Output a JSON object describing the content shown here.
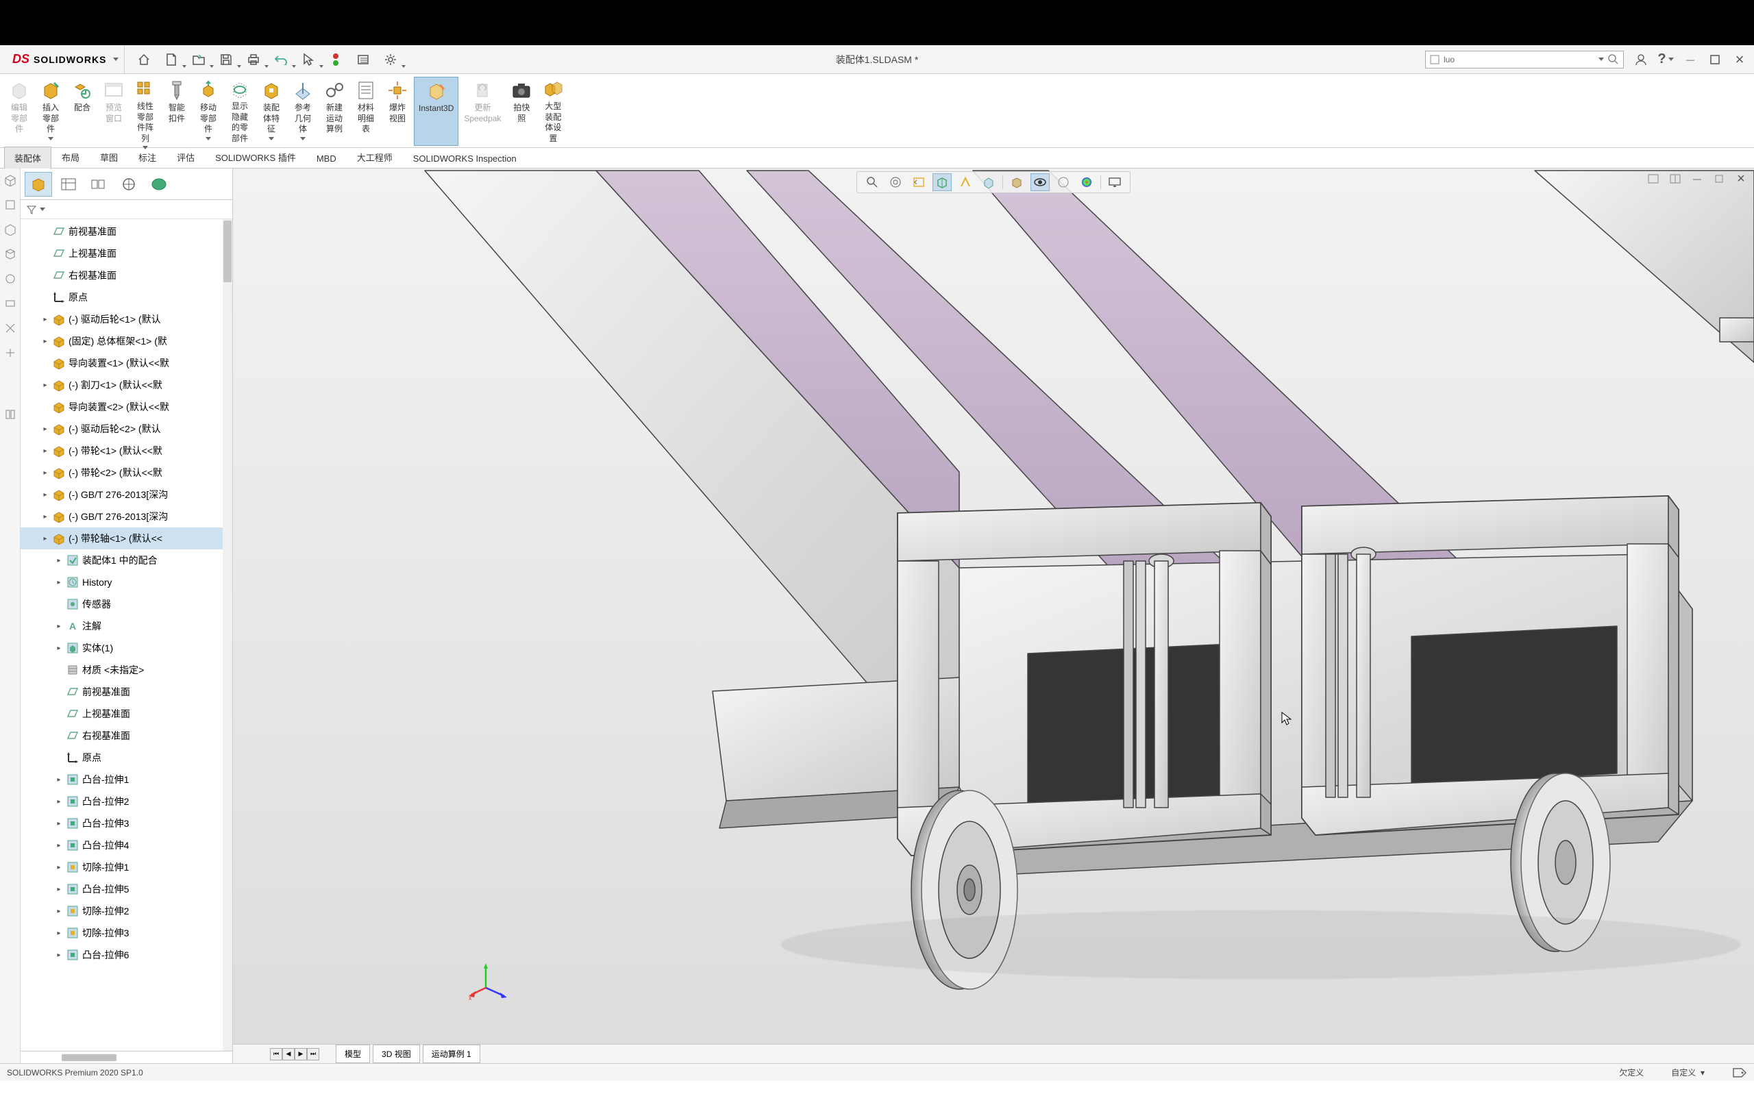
{
  "app": {
    "name": "SOLIDWORKS",
    "document": "装配体1.SLDASM *"
  },
  "search": {
    "placeholder": "luo"
  },
  "ribbonButtons": [
    {
      "id": "edit-part",
      "label": "编辑零部件",
      "disabled": true
    },
    {
      "id": "insert-part",
      "label": "插入零部件",
      "dd": true
    },
    {
      "id": "mate",
      "label": "配合"
    },
    {
      "id": "preview-win",
      "label": "预览窗口",
      "disabled": true
    },
    {
      "id": "linear-pattern",
      "label": "线性零部件阵列",
      "dd": true
    },
    {
      "id": "smart-fastener",
      "label": "智能扣件"
    },
    {
      "id": "move-part",
      "label": "移动零部件",
      "dd": true
    },
    {
      "id": "show-hidden",
      "label": "显示隐藏的零部件"
    },
    {
      "id": "assembly-features",
      "label": "装配体特征",
      "dd": true
    },
    {
      "id": "ref-geom",
      "label": "参考几何体",
      "dd": true
    },
    {
      "id": "new-motion",
      "label": "新建运动算例"
    },
    {
      "id": "bom",
      "label": "材料明细表"
    },
    {
      "id": "exploded",
      "label": "爆炸视图"
    },
    {
      "id": "instant3d",
      "label": "Instant3D",
      "active": true
    },
    {
      "id": "update-speedpak",
      "label": "更新Speedpak",
      "disabled": true
    },
    {
      "id": "snapshot",
      "label": "拍快照"
    },
    {
      "id": "large-asm",
      "label": "大型装配体设置"
    }
  ],
  "ribbonTabs": [
    "装配体",
    "布局",
    "草图",
    "标注",
    "评估",
    "SOLIDWORKS 插件",
    "MBD",
    "大工程师",
    "SOLIDWORKS Inspection"
  ],
  "activeRibbonTab": 0,
  "treeItems": [
    {
      "icon": "plane",
      "label": "前视基准面",
      "indent": 1
    },
    {
      "icon": "plane",
      "label": "上视基准面",
      "indent": 1
    },
    {
      "icon": "plane",
      "label": "右视基准面",
      "indent": 1
    },
    {
      "icon": "origin",
      "label": "原点",
      "indent": 1
    },
    {
      "icon": "asm",
      "label": "(-) 驱动后轮<1> (默认",
      "indent": 1,
      "exp": true
    },
    {
      "icon": "asm",
      "label": "(固定) 总体框架<1> (默",
      "indent": 1,
      "exp": true
    },
    {
      "icon": "asm",
      "label": "导向装置<1> (默认<<默",
      "indent": 1
    },
    {
      "icon": "asm",
      "label": "(-) 割刀<1> (默认<<默",
      "indent": 1,
      "exp": true
    },
    {
      "icon": "asm",
      "label": "导向装置<2> (默认<<默",
      "indent": 1
    },
    {
      "icon": "asm",
      "label": "(-) 驱动后轮<2> (默认",
      "indent": 1,
      "exp": true
    },
    {
      "icon": "asm",
      "label": "(-) 带轮<1> (默认<<默",
      "indent": 1,
      "exp": true
    },
    {
      "icon": "asm",
      "label": "(-) 带轮<2> (默认<<默",
      "indent": 1,
      "exp": true
    },
    {
      "icon": "asm",
      "label": "(-) GB/T 276-2013[深沟",
      "indent": 1,
      "exp": true
    },
    {
      "icon": "asm",
      "label": "(-) GB/T 276-2013[深沟",
      "indent": 1,
      "exp": true
    },
    {
      "icon": "asm",
      "label": "(-) 带轮轴<1> (默认<<",
      "indent": 1,
      "exp": true,
      "selected": true
    },
    {
      "icon": "mates",
      "label": "装配体1 中的配合",
      "indent": 2,
      "exp": true
    },
    {
      "icon": "history",
      "label": "History",
      "indent": 2,
      "exp": true
    },
    {
      "icon": "sensor",
      "label": "传感器",
      "indent": 2
    },
    {
      "icon": "annot",
      "label": "注解",
      "indent": 2,
      "exp": true
    },
    {
      "icon": "solid",
      "label": "实体(1)",
      "indent": 2,
      "exp": true
    },
    {
      "icon": "material",
      "label": "材质 <未指定>",
      "indent": 2
    },
    {
      "icon": "plane",
      "label": "前视基准面",
      "indent": 2
    },
    {
      "icon": "plane",
      "label": "上视基准面",
      "indent": 2
    },
    {
      "icon": "plane",
      "label": "右视基准面",
      "indent": 2
    },
    {
      "icon": "origin",
      "label": "原点",
      "indent": 2
    },
    {
      "icon": "extrude",
      "label": "凸台-拉伸1",
      "indent": 2,
      "exp": true
    },
    {
      "icon": "extrude",
      "label": "凸台-拉伸2",
      "indent": 2,
      "exp": true
    },
    {
      "icon": "extrude",
      "label": "凸台-拉伸3",
      "indent": 2,
      "exp": true
    },
    {
      "icon": "extrude",
      "label": "凸台-拉伸4",
      "indent": 2,
      "exp": true
    },
    {
      "icon": "cut",
      "label": "切除-拉伸1",
      "indent": 2,
      "exp": true
    },
    {
      "icon": "extrude",
      "label": "凸台-拉伸5",
      "indent": 2,
      "exp": true
    },
    {
      "icon": "cut",
      "label": "切除-拉伸2",
      "indent": 2,
      "exp": true
    },
    {
      "icon": "cut",
      "label": "切除-拉伸3",
      "indent": 2,
      "exp": true
    },
    {
      "icon": "extrude",
      "label": "凸台-拉伸6",
      "indent": 2,
      "exp": true
    }
  ],
  "sheetTabs": [
    "模型",
    "3D 视图",
    "运动算例 1"
  ],
  "status": {
    "left": "SOLIDWORKS Premium 2020 SP1.0",
    "under": "欠定义",
    "custom": "自定义"
  }
}
